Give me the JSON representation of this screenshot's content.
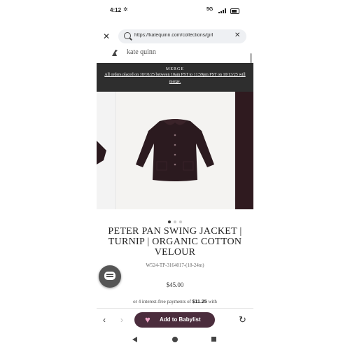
{
  "status": {
    "time": "4:12",
    "network": "5G"
  },
  "browser": {
    "url": "https://katequinn.com/collections/girl",
    "nav_back": "‹",
    "nav_forward": "›"
  },
  "header": {
    "brand": "kate quinn"
  },
  "banner": {
    "title": "MERGE",
    "message": "All orders placed on 10/10/25 between 10am PST to 11:59pm PST on 10/13/25 will merge."
  },
  "carousel": {
    "slide_count": 3,
    "active_index": 0
  },
  "product": {
    "title": "PETER PAN SWING JACKET | TURNIP | ORGANIC COTTON VELOUR",
    "sku": "W524-TP-3164017-(18-24m)",
    "price": "$45.00",
    "installments_prefix": "or 4 interest-free payments of",
    "installments_amount": "$11.25",
    "installments_suffix": "with"
  },
  "toolbar": {
    "add_label": "Add to Babylist"
  },
  "colors": {
    "banner_bg": "#2e2e2e",
    "button_bg": "#4b2d3d",
    "jacket": "#2b1a1f"
  }
}
